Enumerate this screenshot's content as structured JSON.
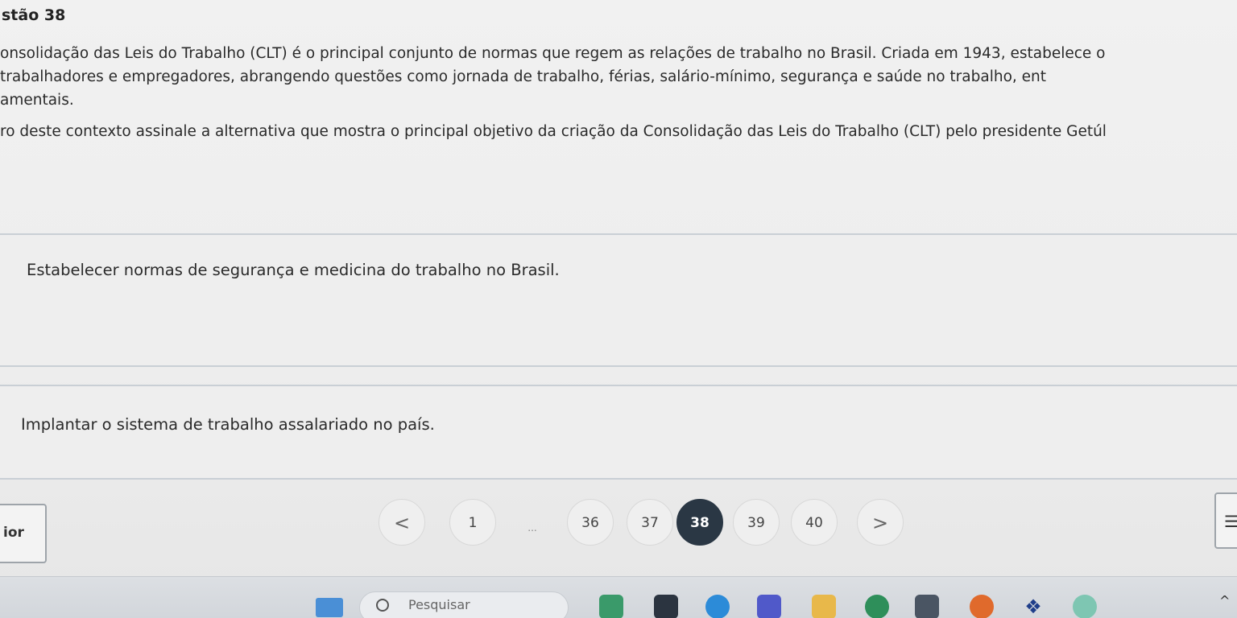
{
  "question": {
    "title": "stão 38",
    "paragraph1": [
      "onsolidação das Leis do Trabalho (CLT) é o principal conjunto de normas que regem as relações de trabalho no Brasil. Criada em 1943, estabelece o",
      "trabalhadores  e  empregadores,  abrangendo  questões  como  jornada  de  trabalho,  férias,  salário-mínimo,  segurança  e  saúde  no  trabalho,  ent",
      "amentais."
    ],
    "paragraph2": "ro deste contexto assinale a alternativa que mostra o principal objetivo da criação da Consolidação das Leis do Trabalho (CLT) pelo presidente Getúl"
  },
  "options": [
    {
      "text": "Estabelecer normas de segurança e medicina do trabalho no Brasil."
    },
    {
      "text": "Implantar o sistema de trabalho assalariado no país."
    }
  ],
  "navigation": {
    "previous_label": "ior",
    "prev_arrow": "<",
    "next_arrow": ">",
    "pages": [
      "1",
      "...",
      "36",
      "37",
      "38",
      "39",
      "40"
    ],
    "current_page": "38",
    "list_icon": "list-icon"
  },
  "taskbar": {
    "search_placeholder": "Pesquisar",
    "icons": [
      "widgets-icon",
      "search-icon",
      "app-icon",
      "file-explorer-icon",
      "edge-icon",
      "teams-icon",
      "folder-icon",
      "chrome-icon",
      "calculator-icon",
      "firefox-icon",
      "dropbox-icon",
      "app-icon",
      "chevron-up-icon"
    ]
  },
  "colors": {
    "active_page": "#2a3744",
    "background": "#ededed",
    "option_border": "#c9cfd5"
  }
}
